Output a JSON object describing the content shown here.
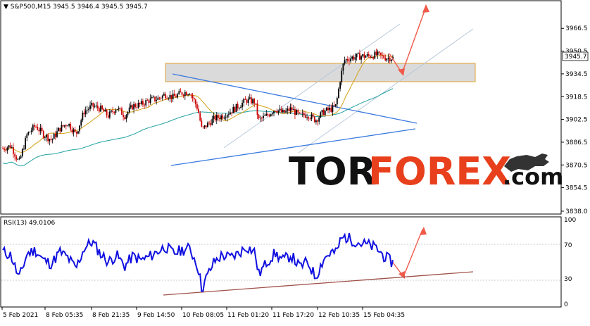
{
  "chart_data": [
    {
      "type": "line",
      "title": "S&P500,M15",
      "ohlc": {
        "open": "3945.5",
        "high": "3946.4",
        "low": "3945.5",
        "close": "3945.7"
      },
      "last_price": "3945.7",
      "ylim": [
        3836,
        3978
      ],
      "y_ticks": [
        "3966.5",
        "3950.5",
        "3934.5",
        "3918.5",
        "3902.5",
        "3886.5",
        "3870.5",
        "3854.5",
        "3838.0"
      ],
      "x_ticks": [
        "5 Feb 2021",
        "8 Feb 05:35",
        "8 Feb 21:35",
        "9 Feb 14:50",
        "10 Feb 08:05",
        "11 Feb 01:20",
        "11 Feb 17:20",
        "12 Feb 10:35",
        "15 Feb 04:35"
      ],
      "colors": {
        "bull_candle": "#000000",
        "bear_candle": "#cc0000",
        "ma_fast": "#d4a017",
        "ma_slow": "#20a0a0",
        "trend": "#3a7ae0",
        "channel": "#b0c4de",
        "forecast": "#f05a4a",
        "zone": "#c8c8c8"
      },
      "price_path": [
        {
          "t": 0,
          "p": 3882
        },
        {
          "t": 0.02,
          "p": 3884
        },
        {
          "t": 0.04,
          "p": 3872
        },
        {
          "t": 0.06,
          "p": 3892
        },
        {
          "t": 0.08,
          "p": 3898
        },
        {
          "t": 0.1,
          "p": 3892
        },
        {
          "t": 0.12,
          "p": 3888
        },
        {
          "t": 0.14,
          "p": 3896
        },
        {
          "t": 0.16,
          "p": 3900
        },
        {
          "t": 0.18,
          "p": 3892
        },
        {
          "t": 0.2,
          "p": 3908
        },
        {
          "t": 0.22,
          "p": 3912
        },
        {
          "t": 0.24,
          "p": 3910
        },
        {
          "t": 0.26,
          "p": 3905
        },
        {
          "t": 0.28,
          "p": 3911
        },
        {
          "t": 0.3,
          "p": 3905
        },
        {
          "t": 0.32,
          "p": 3912
        },
        {
          "t": 0.34,
          "p": 3913
        },
        {
          "t": 0.36,
          "p": 3916
        },
        {
          "t": 0.38,
          "p": 3917
        },
        {
          "t": 0.4,
          "p": 3920
        },
        {
          "t": 0.42,
          "p": 3918
        },
        {
          "t": 0.44,
          "p": 3921
        },
        {
          "t": 0.46,
          "p": 3922
        },
        {
          "t": 0.48,
          "p": 3910
        },
        {
          "t": 0.49,
          "p": 3895
        },
        {
          "t": 0.5,
          "p": 3898
        },
        {
          "t": 0.52,
          "p": 3903
        },
        {
          "t": 0.54,
          "p": 3905
        },
        {
          "t": 0.56,
          "p": 3908
        },
        {
          "t": 0.58,
          "p": 3912
        },
        {
          "t": 0.6,
          "p": 3916
        },
        {
          "t": 0.62,
          "p": 3915
        },
        {
          "t": 0.63,
          "p": 3902
        },
        {
          "t": 0.65,
          "p": 3905
        },
        {
          "t": 0.67,
          "p": 3910
        },
        {
          "t": 0.69,
          "p": 3907
        },
        {
          "t": 0.71,
          "p": 3910
        },
        {
          "t": 0.73,
          "p": 3905
        },
        {
          "t": 0.75,
          "p": 3906
        },
        {
          "t": 0.77,
          "p": 3902
        },
        {
          "t": 0.79,
          "p": 3908
        },
        {
          "t": 0.81,
          "p": 3910
        },
        {
          "t": 0.82,
          "p": 3912
        },
        {
          "t": 0.83,
          "p": 3930
        },
        {
          "t": 0.84,
          "p": 3944
        },
        {
          "t": 0.86,
          "p": 3946
        },
        {
          "t": 0.88,
          "p": 3947
        },
        {
          "t": 0.9,
          "p": 3947
        },
        {
          "t": 0.92,
          "p": 3948
        },
        {
          "t": 0.94,
          "p": 3946
        },
        {
          "t": 0.96,
          "p": 3945.7
        }
      ],
      "annotations": [
        "resistance-zone",
        "descending-trendline",
        "ascending-trendline",
        "rising-channel",
        "forecast-arrows"
      ]
    },
    {
      "type": "line",
      "title": "RSI(13) 49.0106",
      "ylim": [
        0,
        100
      ],
      "y_ticks": [
        "100",
        "70",
        "30",
        "0"
      ],
      "levels": [
        70,
        30
      ],
      "color": "#1010e0",
      "rsi_path": [
        {
          "t": 0,
          "v": 62
        },
        {
          "t": 0.02,
          "v": 58
        },
        {
          "t": 0.04,
          "v": 30
        },
        {
          "t": 0.06,
          "v": 60
        },
        {
          "t": 0.08,
          "v": 64
        },
        {
          "t": 0.1,
          "v": 52
        },
        {
          "t": 0.12,
          "v": 48
        },
        {
          "t": 0.14,
          "v": 62
        },
        {
          "t": 0.16,
          "v": 55
        },
        {
          "t": 0.18,
          "v": 42
        },
        {
          "t": 0.2,
          "v": 66
        },
        {
          "t": 0.22,
          "v": 74
        },
        {
          "t": 0.24,
          "v": 60
        },
        {
          "t": 0.26,
          "v": 50
        },
        {
          "t": 0.28,
          "v": 58
        },
        {
          "t": 0.3,
          "v": 45
        },
        {
          "t": 0.32,
          "v": 57
        },
        {
          "t": 0.34,
          "v": 52
        },
        {
          "t": 0.36,
          "v": 56
        },
        {
          "t": 0.38,
          "v": 62
        },
        {
          "t": 0.4,
          "v": 68
        },
        {
          "t": 0.42,
          "v": 60
        },
        {
          "t": 0.44,
          "v": 64
        },
        {
          "t": 0.46,
          "v": 66
        },
        {
          "t": 0.48,
          "v": 45
        },
        {
          "t": 0.49,
          "v": 18
        },
        {
          "t": 0.5,
          "v": 30
        },
        {
          "t": 0.52,
          "v": 50
        },
        {
          "t": 0.54,
          "v": 58
        },
        {
          "t": 0.56,
          "v": 55
        },
        {
          "t": 0.58,
          "v": 60
        },
        {
          "t": 0.6,
          "v": 68
        },
        {
          "t": 0.62,
          "v": 62
        },
        {
          "t": 0.63,
          "v": 35
        },
        {
          "t": 0.65,
          "v": 50
        },
        {
          "t": 0.67,
          "v": 60
        },
        {
          "t": 0.69,
          "v": 52
        },
        {
          "t": 0.71,
          "v": 58
        },
        {
          "t": 0.73,
          "v": 44
        },
        {
          "t": 0.75,
          "v": 50
        },
        {
          "t": 0.77,
          "v": 32
        },
        {
          "t": 0.79,
          "v": 54
        },
        {
          "t": 0.81,
          "v": 62
        },
        {
          "t": 0.82,
          "v": 60
        },
        {
          "t": 0.83,
          "v": 74
        },
        {
          "t": 0.84,
          "v": 80
        },
        {
          "t": 0.86,
          "v": 76
        },
        {
          "t": 0.88,
          "v": 72
        },
        {
          "t": 0.9,
          "v": 70
        },
        {
          "t": 0.92,
          "v": 66
        },
        {
          "t": 0.94,
          "v": 56
        },
        {
          "t": 0.96,
          "v": 49
        }
      ]
    }
  ],
  "watermark": {
    "text": "TORFOREX.com"
  }
}
